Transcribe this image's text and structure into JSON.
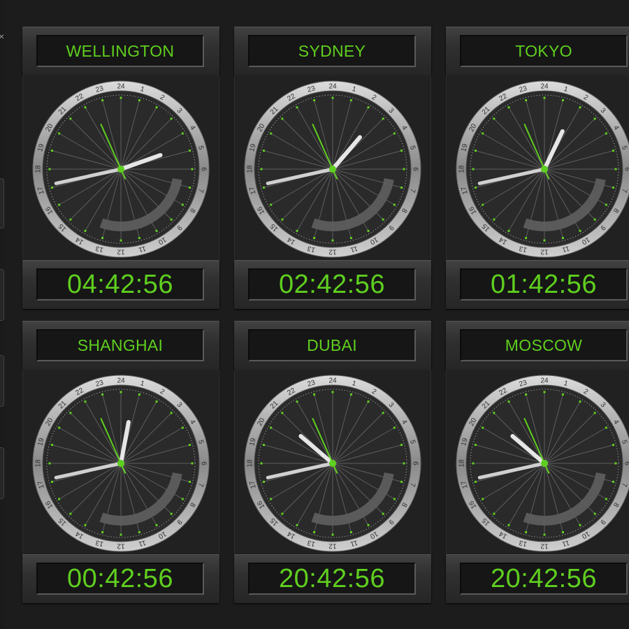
{
  "colors": {
    "accent_green": "#5fcf1f",
    "hand_white": "#e6e6e6",
    "background": "#1c1c1c"
  },
  "dial_numbers": [
    "24",
    "1",
    "2",
    "3",
    "4",
    "5",
    "6",
    "7",
    "8",
    "9",
    "10",
    "11",
    "12",
    "13",
    "14",
    "15",
    "16",
    "17",
    "18",
    "19",
    "20",
    "21",
    "22",
    "23"
  ],
  "clocks": [
    {
      "city": "WELLINGTON",
      "time": "04:42:56",
      "hour": 4,
      "minute": 42,
      "second": 56
    },
    {
      "city": "SYDNEY",
      "time": "02:42:56",
      "hour": 2,
      "minute": 42,
      "second": 56
    },
    {
      "city": "TOKYO",
      "time": "01:42:56",
      "hour": 1,
      "minute": 42,
      "second": 56
    },
    {
      "city": "SHANGHAI",
      "time": "00:42:56",
      "hour": 0,
      "minute": 42,
      "second": 56
    },
    {
      "city": "DUBAI",
      "time": "20:42:56",
      "hour": 20,
      "minute": 42,
      "second": 56
    },
    {
      "city": "MOSCOW",
      "time": "20:42:56",
      "hour": 20,
      "minute": 42,
      "second": 56
    }
  ]
}
